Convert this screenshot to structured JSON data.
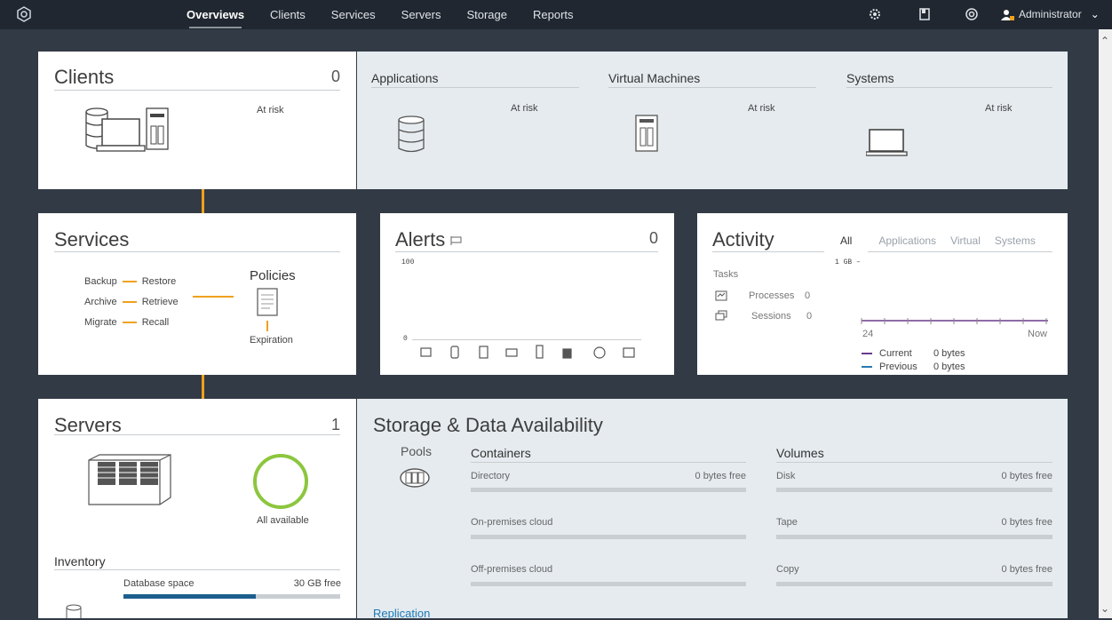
{
  "nav": {
    "items": [
      "Overviews",
      "Clients",
      "Services",
      "Servers",
      "Storage",
      "Reports"
    ],
    "active": "Overviews",
    "user": "Administrator"
  },
  "clients": {
    "title": "Clients",
    "count": "0",
    "at_risk": "At risk",
    "sections": [
      {
        "title": "Applications",
        "at_risk": "At risk"
      },
      {
        "title": "Virtual Machines",
        "at_risk": "At risk"
      },
      {
        "title": "Systems",
        "at_risk": "At risk"
      }
    ]
  },
  "services": {
    "title": "Services",
    "pairs": [
      [
        "Backup",
        "Restore"
      ],
      [
        "Archive",
        "Retrieve"
      ],
      [
        "Migrate",
        "Recall"
      ]
    ],
    "policies": "Policies",
    "expiration": "Expiration"
  },
  "alerts": {
    "title": "Alerts",
    "count": "0",
    "y_max": "100",
    "y_min": "0"
  },
  "activity": {
    "title": "Activity",
    "tabs": [
      "All",
      "Applications",
      "Virtual",
      "Systems"
    ],
    "active_tab": "All",
    "gb_label": "1 GB –",
    "tasks": "Tasks",
    "processes_label": "Processes",
    "processes_value": "0",
    "sessions_label": "Sessions",
    "sessions_value": "0",
    "axis_start": "24",
    "axis_end": "Now",
    "legend": [
      {
        "name": "Current",
        "value": "0 bytes",
        "color": "#6b3a8c"
      },
      {
        "name": "Previous",
        "value": "0 bytes",
        "color": "#2a7ab0"
      }
    ]
  },
  "servers": {
    "title": "Servers",
    "count": "1",
    "status": "All available",
    "inventory": "Inventory",
    "db_label": "Database space",
    "db_free": "30 GB free",
    "db_used_fraction": 0.61
  },
  "storage": {
    "title": "Storage & Data Availability",
    "pools": "Pools",
    "containers_title": "Containers",
    "volumes_title": "Volumes",
    "containers": [
      {
        "name": "Directory",
        "free": "0 bytes free"
      },
      {
        "name": "On-premises cloud",
        "free": ""
      },
      {
        "name": "Off-premises cloud",
        "free": ""
      }
    ],
    "volumes": [
      {
        "name": "Disk",
        "free": "0 bytes free"
      },
      {
        "name": "Tape",
        "free": "0 bytes free"
      },
      {
        "name": "Copy",
        "free": "0 bytes free"
      }
    ],
    "replication": "Replication"
  },
  "colors": {
    "accent": "#f0a11e",
    "topbar": "#212730",
    "background": "#323a45",
    "link": "#1a7ab6"
  }
}
